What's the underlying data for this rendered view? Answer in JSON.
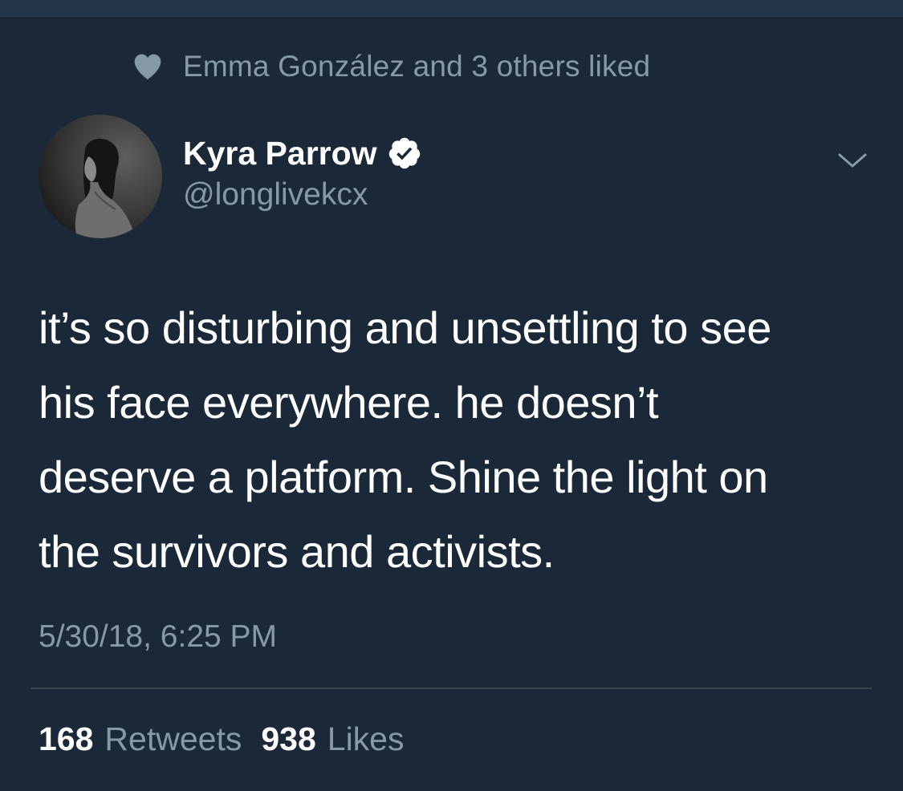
{
  "social_context": {
    "text": "Emma González and 3 others liked",
    "icon": "heart-icon"
  },
  "author": {
    "display_name": "Kyra Parrow",
    "handle": "@longlivekcx",
    "verified": true,
    "avatar_icon": "avatar"
  },
  "tweet": {
    "lines": [
      "it’s so disturbing and unsettling to see",
      "his face everywhere. he doesn’t",
      "deserve a platform. Shine the light on",
      "the survivors and activists."
    ],
    "timestamp": "5/30/18, 6:25 PM"
  },
  "stats": {
    "retweets_count": "168",
    "retweets_label": "Retweets",
    "likes_count": "938",
    "likes_label": "Likes"
  },
  "colors": {
    "background": "#1b2838",
    "secondary_text": "#8899a6",
    "primary_text": "#ffffff",
    "divider": "#38444d"
  }
}
